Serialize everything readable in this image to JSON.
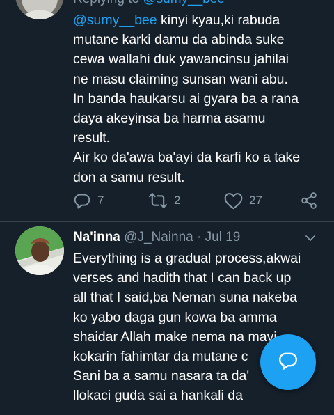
{
  "tweet1": {
    "replying_prefix": "Replying to",
    "replying_mention": "@sumy__bee",
    "mention": "@sumy__bee",
    "text": " kinyi kyau,ki rabuda\nmutane karki damu da abinda suke\ncewa wallahi duk yawancinsu jahilai\nne masu claiming sunsan wani abu.\nIn banda haukarsu ai gyara ba a rana\ndaya akeyinsa ba harma asamu\nresult.\nAir ko da'awa ba'ayi da karfi ko a take\ndon a samu result.",
    "reply_count": "7",
    "retweet_count": "2",
    "like_count": "27"
  },
  "tweet2": {
    "name": "Na'inna",
    "handle": "@J_Nainna",
    "separator": "·",
    "date": "Jul 19",
    "text": "Everything is a gradual process,akwai\nverses and hadith that I can back up\nall that I said,ba Neman suna nakeba\nko yabo daga gun kowa ba amma\nshaidar Allah make nema na mayi\nkokarin fahimtar da mutane c\nSani ba a samu nasara ta da'\nllokaci guda sai a hankali da"
  },
  "icons": {
    "reply": "reply-icon",
    "retweet": "retweet-icon",
    "like": "heart-icon",
    "share": "share-icon",
    "menu": "chevron-down-icon",
    "compose": "compose-message-icon"
  },
  "colors": {
    "background": "#15202b",
    "accent": "#1da1f2",
    "secondary_text": "#8899a6",
    "divider": "#38444d"
  }
}
